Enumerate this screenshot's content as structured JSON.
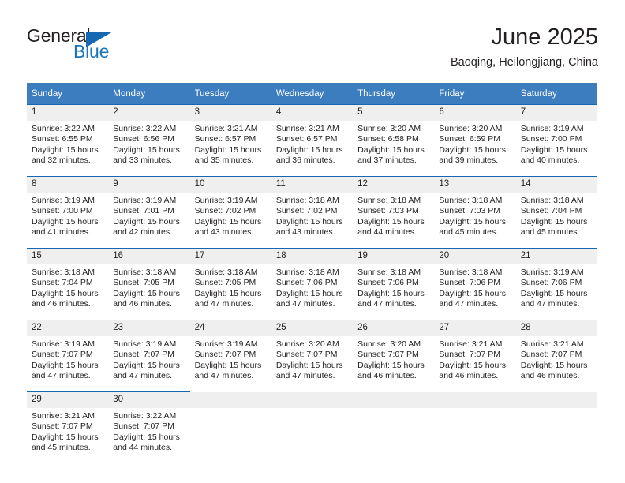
{
  "logo": {
    "word_top": "General",
    "word_bottom": "Blue",
    "triangle_color": "#1668b3",
    "blue_text_color": "#1b75bb"
  },
  "header": {
    "title": "June 2025",
    "location": "Baoqing, Heilongjiang, China"
  },
  "theme": {
    "header_blue": "#3b7dbf",
    "row_rule_blue": "#1668b3",
    "daynum_band": "#efefef",
    "text": "#231f20"
  },
  "weekdays": [
    "Sunday",
    "Monday",
    "Tuesday",
    "Wednesday",
    "Thursday",
    "Friday",
    "Saturday"
  ],
  "weeks": [
    [
      {
        "day": "1",
        "sunrise": "Sunrise: 3:22 AM",
        "sunset": "Sunset: 6:55 PM",
        "daylight_line1": "Daylight: 15 hours",
        "daylight_line2": "and 32 minutes."
      },
      {
        "day": "2",
        "sunrise": "Sunrise: 3:22 AM",
        "sunset": "Sunset: 6:56 PM",
        "daylight_line1": "Daylight: 15 hours",
        "daylight_line2": "and 33 minutes."
      },
      {
        "day": "3",
        "sunrise": "Sunrise: 3:21 AM",
        "sunset": "Sunset: 6:57 PM",
        "daylight_line1": "Daylight: 15 hours",
        "daylight_line2": "and 35 minutes."
      },
      {
        "day": "4",
        "sunrise": "Sunrise: 3:21 AM",
        "sunset": "Sunset: 6:57 PM",
        "daylight_line1": "Daylight: 15 hours",
        "daylight_line2": "and 36 minutes."
      },
      {
        "day": "5",
        "sunrise": "Sunrise: 3:20 AM",
        "sunset": "Sunset: 6:58 PM",
        "daylight_line1": "Daylight: 15 hours",
        "daylight_line2": "and 37 minutes."
      },
      {
        "day": "6",
        "sunrise": "Sunrise: 3:20 AM",
        "sunset": "Sunset: 6:59 PM",
        "daylight_line1": "Daylight: 15 hours",
        "daylight_line2": "and 39 minutes."
      },
      {
        "day": "7",
        "sunrise": "Sunrise: 3:19 AM",
        "sunset": "Sunset: 7:00 PM",
        "daylight_line1": "Daylight: 15 hours",
        "daylight_line2": "and 40 minutes."
      }
    ],
    [
      {
        "day": "8",
        "sunrise": "Sunrise: 3:19 AM",
        "sunset": "Sunset: 7:00 PM",
        "daylight_line1": "Daylight: 15 hours",
        "daylight_line2": "and 41 minutes."
      },
      {
        "day": "9",
        "sunrise": "Sunrise: 3:19 AM",
        "sunset": "Sunset: 7:01 PM",
        "daylight_line1": "Daylight: 15 hours",
        "daylight_line2": "and 42 minutes."
      },
      {
        "day": "10",
        "sunrise": "Sunrise: 3:19 AM",
        "sunset": "Sunset: 7:02 PM",
        "daylight_line1": "Daylight: 15 hours",
        "daylight_line2": "and 43 minutes."
      },
      {
        "day": "11",
        "sunrise": "Sunrise: 3:18 AM",
        "sunset": "Sunset: 7:02 PM",
        "daylight_line1": "Daylight: 15 hours",
        "daylight_line2": "and 43 minutes."
      },
      {
        "day": "12",
        "sunrise": "Sunrise: 3:18 AM",
        "sunset": "Sunset: 7:03 PM",
        "daylight_line1": "Daylight: 15 hours",
        "daylight_line2": "and 44 minutes."
      },
      {
        "day": "13",
        "sunrise": "Sunrise: 3:18 AM",
        "sunset": "Sunset: 7:03 PM",
        "daylight_line1": "Daylight: 15 hours",
        "daylight_line2": "and 45 minutes."
      },
      {
        "day": "14",
        "sunrise": "Sunrise: 3:18 AM",
        "sunset": "Sunset: 7:04 PM",
        "daylight_line1": "Daylight: 15 hours",
        "daylight_line2": "and 45 minutes."
      }
    ],
    [
      {
        "day": "15",
        "sunrise": "Sunrise: 3:18 AM",
        "sunset": "Sunset: 7:04 PM",
        "daylight_line1": "Daylight: 15 hours",
        "daylight_line2": "and 46 minutes."
      },
      {
        "day": "16",
        "sunrise": "Sunrise: 3:18 AM",
        "sunset": "Sunset: 7:05 PM",
        "daylight_line1": "Daylight: 15 hours",
        "daylight_line2": "and 46 minutes."
      },
      {
        "day": "17",
        "sunrise": "Sunrise: 3:18 AM",
        "sunset": "Sunset: 7:05 PM",
        "daylight_line1": "Daylight: 15 hours",
        "daylight_line2": "and 47 minutes."
      },
      {
        "day": "18",
        "sunrise": "Sunrise: 3:18 AM",
        "sunset": "Sunset: 7:06 PM",
        "daylight_line1": "Daylight: 15 hours",
        "daylight_line2": "and 47 minutes."
      },
      {
        "day": "19",
        "sunrise": "Sunrise: 3:18 AM",
        "sunset": "Sunset: 7:06 PM",
        "daylight_line1": "Daylight: 15 hours",
        "daylight_line2": "and 47 minutes."
      },
      {
        "day": "20",
        "sunrise": "Sunrise: 3:18 AM",
        "sunset": "Sunset: 7:06 PM",
        "daylight_line1": "Daylight: 15 hours",
        "daylight_line2": "and 47 minutes."
      },
      {
        "day": "21",
        "sunrise": "Sunrise: 3:19 AM",
        "sunset": "Sunset: 7:06 PM",
        "daylight_line1": "Daylight: 15 hours",
        "daylight_line2": "and 47 minutes."
      }
    ],
    [
      {
        "day": "22",
        "sunrise": "Sunrise: 3:19 AM",
        "sunset": "Sunset: 7:07 PM",
        "daylight_line1": "Daylight: 15 hours",
        "daylight_line2": "and 47 minutes."
      },
      {
        "day": "23",
        "sunrise": "Sunrise: 3:19 AM",
        "sunset": "Sunset: 7:07 PM",
        "daylight_line1": "Daylight: 15 hours",
        "daylight_line2": "and 47 minutes."
      },
      {
        "day": "24",
        "sunrise": "Sunrise: 3:19 AM",
        "sunset": "Sunset: 7:07 PM",
        "daylight_line1": "Daylight: 15 hours",
        "daylight_line2": "and 47 minutes."
      },
      {
        "day": "25",
        "sunrise": "Sunrise: 3:20 AM",
        "sunset": "Sunset: 7:07 PM",
        "daylight_line1": "Daylight: 15 hours",
        "daylight_line2": "and 47 minutes."
      },
      {
        "day": "26",
        "sunrise": "Sunrise: 3:20 AM",
        "sunset": "Sunset: 7:07 PM",
        "daylight_line1": "Daylight: 15 hours",
        "daylight_line2": "and 46 minutes."
      },
      {
        "day": "27",
        "sunrise": "Sunrise: 3:21 AM",
        "sunset": "Sunset: 7:07 PM",
        "daylight_line1": "Daylight: 15 hours",
        "daylight_line2": "and 46 minutes."
      },
      {
        "day": "28",
        "sunrise": "Sunrise: 3:21 AM",
        "sunset": "Sunset: 7:07 PM",
        "daylight_line1": "Daylight: 15 hours",
        "daylight_line2": "and 46 minutes."
      }
    ],
    [
      {
        "day": "29",
        "sunrise": "Sunrise: 3:21 AM",
        "sunset": "Sunset: 7:07 PM",
        "daylight_line1": "Daylight: 15 hours",
        "daylight_line2": "and 45 minutes."
      },
      {
        "day": "30",
        "sunrise": "Sunrise: 3:22 AM",
        "sunset": "Sunset: 7:07 PM",
        "daylight_line1": "Daylight: 15 hours",
        "daylight_line2": "and 44 minutes."
      },
      {
        "day": "",
        "sunrise": "",
        "sunset": "",
        "daylight_line1": "",
        "daylight_line2": ""
      },
      {
        "day": "",
        "sunrise": "",
        "sunset": "",
        "daylight_line1": "",
        "daylight_line2": ""
      },
      {
        "day": "",
        "sunrise": "",
        "sunset": "",
        "daylight_line1": "",
        "daylight_line2": ""
      },
      {
        "day": "",
        "sunrise": "",
        "sunset": "",
        "daylight_line1": "",
        "daylight_line2": ""
      },
      {
        "day": "",
        "sunrise": "",
        "sunset": "",
        "daylight_line1": "",
        "daylight_line2": ""
      }
    ]
  ]
}
